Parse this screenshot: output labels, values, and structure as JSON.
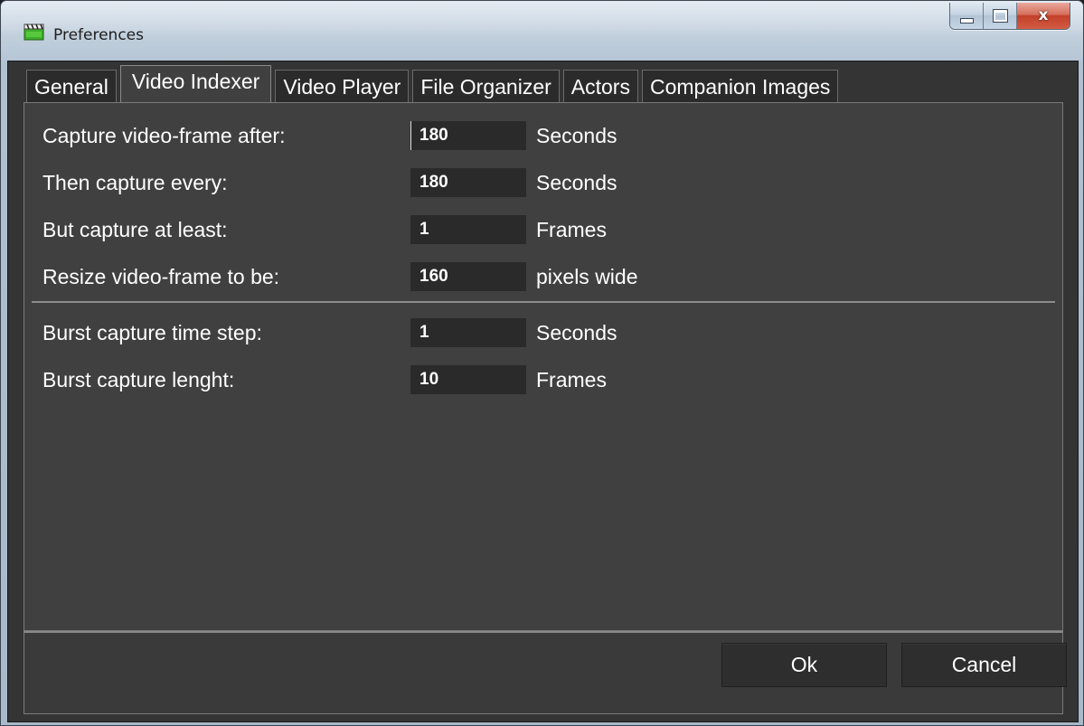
{
  "window": {
    "title": "Preferences",
    "icon": "clapperboard-icon",
    "controls": {
      "minimize": "minimize-icon",
      "maximize": "maximize-icon",
      "close_label": "x"
    }
  },
  "tabs": [
    {
      "label": "General",
      "active": false
    },
    {
      "label": "Video Indexer",
      "active": true
    },
    {
      "label": "Video Player",
      "active": false
    },
    {
      "label": "File Organizer",
      "active": false
    },
    {
      "label": "Actors",
      "active": false
    },
    {
      "label": "Companion Images",
      "active": false
    }
  ],
  "video_indexer": {
    "capture_after": {
      "label": "Capture video-frame after:",
      "value": "180",
      "unit": "Seconds"
    },
    "capture_every": {
      "label": "Then capture every:",
      "value": "180",
      "unit": "Seconds"
    },
    "capture_at_least": {
      "label": "But capture at least:",
      "value": "1",
      "unit": "Frames"
    },
    "resize_frame": {
      "label": "Resize video-frame to be:",
      "value": "160",
      "unit": "pixels wide"
    },
    "burst_time_step": {
      "label": "Burst capture time step:",
      "value": "1",
      "unit": "Seconds"
    },
    "burst_length": {
      "label": "Burst capture lenght:",
      "value": "10",
      "unit": "Frames"
    }
  },
  "buttons": {
    "ok": "Ok",
    "cancel": "Cancel"
  },
  "colors": {
    "panel_bg": "#404040",
    "input_bg": "#2a2a2a",
    "text": "#ffffff",
    "close_button": "#c2402a"
  }
}
